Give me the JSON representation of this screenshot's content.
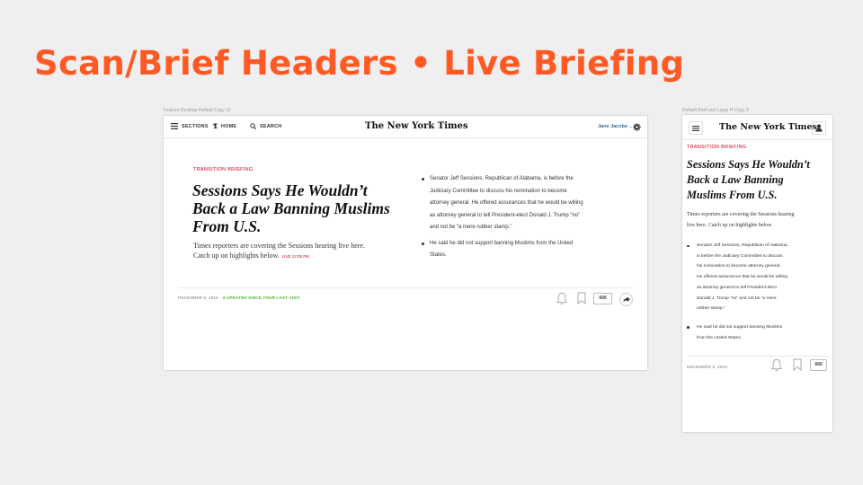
{
  "slide": {
    "title": "Scan/Brief Headers • Live Briefing"
  },
  "desktop": {
    "frame_label": "Feature-Desktop-Default Copy 11",
    "nav": {
      "sections_label": "SECTIONS",
      "home_label": "HOME",
      "search_label": "SEARCH",
      "logo_text": "The New York Times",
      "user_name": "Jane Jacobs"
    },
    "article": {
      "kicker": "TRANSITION BRIEFING",
      "headline_lines": [
        "Sessions Says He Wouldn’t",
        "Back a Law Banning Muslims",
        "From U.S."
      ],
      "summary_line1": "Times reporters are covering the Sessions hearing live here.",
      "summary_line2": "Catch up on highlights below.",
      "live_time": "LIVE 12:05 PM"
    },
    "bullets": [
      {
        "lines": [
          "Senator Jeff Sessions, Republican of Alabama, is before the",
          "Judiciary Committee to discuss his nomination to become",
          "attorney general. He offered assurances that he would be willing",
          "as attorney general to tell President-elect Donald J. Trump “no”",
          "and not be “a mere rubber stamp.”"
        ]
      },
      {
        "lines": [
          "He said he did not support banning Muslims from the United",
          "States."
        ]
      }
    ],
    "footer": {
      "date": "DECEMBER 6, 2016",
      "updates": "5 UPDATES SINCE YOUR LAST VISIT",
      "comment_count": "888"
    }
  },
  "mobile": {
    "frame_label": "Default Brief and Large H Copy 3",
    "logo_text": "The New York Times",
    "article": {
      "kicker": "TRANSITION BRIEFING",
      "headline_lines": [
        "Sessions Says He Wouldn’t",
        "Back a Law Banning",
        "Muslims From U.S."
      ],
      "summary_line1": "Times reporters are covering the Sessions hearing",
      "summary_line2": "live here. Catch up on highlights below."
    },
    "bullets": [
      {
        "lines": [
          "Senator Jeff Sessions, Republican of Alabama,",
          "is before the Judiciary Committee to discuss",
          "his nomination to become attorney general.",
          "He offered assurances that he would be willing",
          "as attorney general to tell President-elect",
          "Donald J. Trump “no” and not be “a mere",
          "rubber stamp.”"
        ]
      },
      {
        "lines": [
          "He said he did not support banning Muslims",
          "from the United States."
        ]
      }
    ],
    "footer": {
      "date": "DECEMBER 6, 2016",
      "comment_count": "888"
    }
  }
}
